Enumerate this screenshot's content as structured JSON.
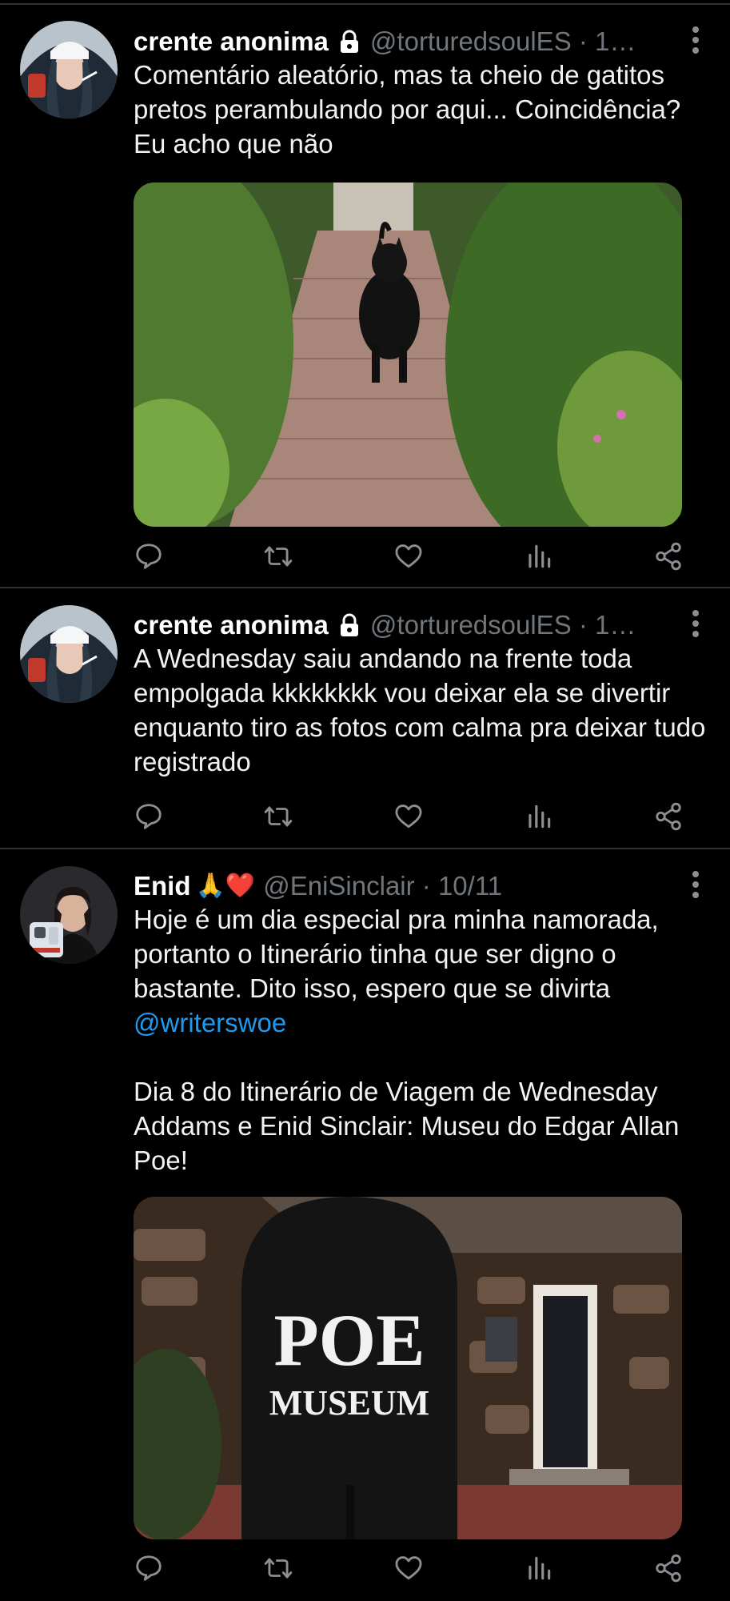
{
  "tweets": [
    {
      "author_name": "crente anonima",
      "handle_time": "@torturedsoulES · 1…",
      "text": "Comentário aleatório, mas ta cheio de gatitos pretos perambulando por aqui... Coincidência? Eu acho que não",
      "has_media": true
    },
    {
      "author_name": "crente anonima",
      "handle_time": "@torturedsoulES · 1…",
      "text": "A Wednesday saiu andando na frente toda empolgada kkkkkkkk vou deixar ela se divertir enquanto tiro as fotos com calma pra deixar tudo registrado",
      "has_media": false
    },
    {
      "author_name": "Enid",
      "author_emoji": "🙏❤️",
      "handle_time": "@EniSinclair · 10/11",
      "text_before_mention": "Hoje é um dia especial pra minha namorada, portanto o Itinerário tinha que ser digno o bastante. Dito isso, espero que se divirta ",
      "mention": "@writerswoe",
      "text_after_mention": "\n\nDia 8 do Itinerário de Viagem de Wednesday Addams e Enid Sinclair: Museu do Edgar Allan Poe!",
      "media_sign_line1": "POE",
      "media_sign_line2": "MUSEUM",
      "has_media": true
    }
  ],
  "icons": [
    "reply-icon",
    "retweet-icon",
    "like-icon",
    "analytics-icon",
    "share-icon",
    "more-icon",
    "lock-icon"
  ],
  "colors": {
    "background": "#000000",
    "text": "#e7e9ea",
    "secondary": "#71767b",
    "link": "#1d9bf0",
    "divider": "#2f3336"
  }
}
